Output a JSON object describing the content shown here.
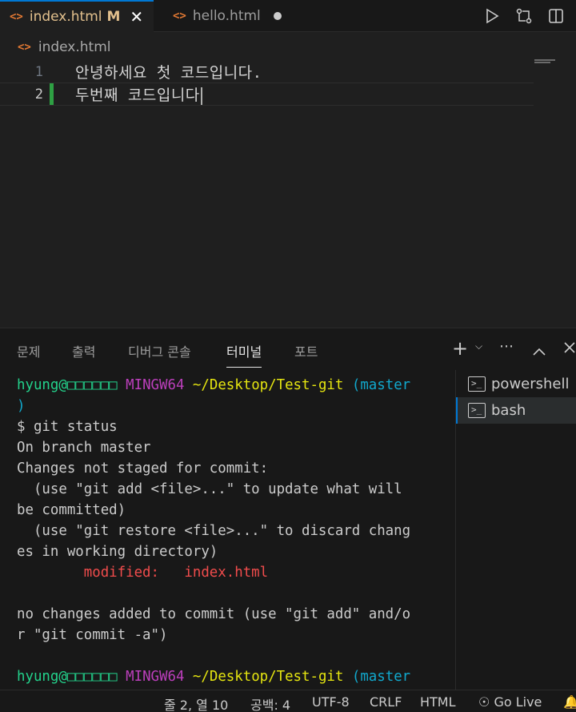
{
  "tabs": [
    {
      "icon": "<>",
      "name": "index.html",
      "badge": "M",
      "close": "✕"
    },
    {
      "icon": "<>",
      "name": "hello.html"
    }
  ],
  "breadcrumb": {
    "icon": "<>",
    "file": "index.html"
  },
  "editor": {
    "lines": [
      {
        "num": "1",
        "text": "안녕하세요 첫 코드입니다."
      },
      {
        "num": "2",
        "text": "두번째 코드입니다"
      }
    ]
  },
  "panel": {
    "tabs": [
      "문제",
      "출력",
      "디버그 콘솔",
      "터미널",
      "포트"
    ],
    "active_tab": "터미널"
  },
  "terminal": {
    "user": "hyung@□□□□□□",
    "host": "MINGW64",
    "path": "~/Desktop/Test-git",
    "branch": "(master",
    "branch_close": ")",
    "cmd": "$ git status",
    "out1": "On branch master",
    "out2": "Changes not staged for commit:",
    "out3": "  (use \"git add <file>...\" to update what will",
    "out4": "be committed)",
    "out5": "  (use \"git restore <file>...\" to discard chang",
    "out6": "es in working directory)",
    "mod_label": "        modified:   index.html",
    "out7": "no changes added to commit (use \"git add\" and/o",
    "out8": "r \"git commit -a\")",
    "branch2": "(master"
  },
  "terminals": [
    {
      "name": "powershell",
      "icon": "terminal-icon"
    },
    {
      "name": "bash",
      "icon": "terminal-icon"
    }
  ],
  "statusbar": {
    "position": "줄 2, 열 10",
    "spaces": "공백: 4",
    "encoding": "UTF-8",
    "eol": "CRLF",
    "language": "HTML",
    "golive": "Go Live"
  },
  "colors": {
    "accent": "#0078d4",
    "modified": "#e2c08d",
    "added_gutter": "#2ea043"
  }
}
